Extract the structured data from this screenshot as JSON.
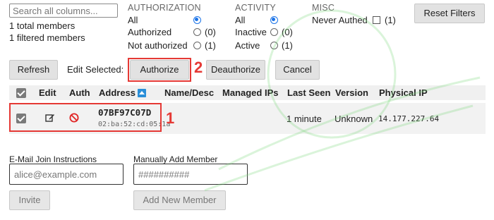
{
  "search": {
    "placeholder": "Search all columns..."
  },
  "stats": {
    "total": "1 total members",
    "filtered": "1 filtered members"
  },
  "filters": {
    "authorization": {
      "heading": "AUTHORIZATION",
      "options": [
        {
          "label": "All",
          "count": "",
          "selected": true
        },
        {
          "label": "Authorized",
          "count": "(0)",
          "selected": false
        },
        {
          "label": "Not authorized",
          "count": "(1)",
          "selected": false
        }
      ]
    },
    "activity": {
      "heading": "ACTIVITY",
      "options": [
        {
          "label": "All",
          "count": "",
          "selected": true
        },
        {
          "label": "Inactive",
          "count": "(0)",
          "selected": false
        },
        {
          "label": "Active",
          "count": "(1)",
          "selected": false
        }
      ]
    },
    "misc": {
      "heading": "MISC",
      "options": [
        {
          "label": "Never Authed",
          "count": "(1)",
          "checked": false
        }
      ]
    }
  },
  "toolbar": {
    "reset_filters": "Reset Filters",
    "refresh": "Refresh",
    "edit_selected": "Edit Selected:",
    "authorize": "Authorize",
    "deauthorize": "Deauthorize",
    "cancel": "Cancel"
  },
  "table": {
    "headers": [
      "Edit",
      "Auth",
      "Address",
      "Name/Desc",
      "Managed IPs",
      "Last Seen",
      "Version",
      "Physical IP"
    ],
    "sort_icon": "sort-ascending-icon",
    "rows": [
      {
        "selected": true,
        "edit_icon": "edit-icon",
        "auth_icon": "not-authorized-icon",
        "address": "07BF97C07D",
        "mac": "02:ba:52:cd:05:1a",
        "name": "",
        "managed_ips": "",
        "last_seen": "1 minute",
        "version": "Unknown",
        "physical_ip": "14.177.227.64"
      }
    ]
  },
  "annotations": {
    "one": "1",
    "two": "2"
  },
  "join": {
    "label": "E-Mail Join Instructions",
    "placeholder": "alice@example.com",
    "button": "Invite"
  },
  "add_member": {
    "label": "Manually Add Member",
    "placeholder": "##########",
    "button": "Add New Member"
  },
  "colors": {
    "accent": "#1a73e8",
    "annotation_red": "#e53935",
    "auth_icon_red": "#e02424",
    "sort_icon_blue": "#2b8fd8",
    "watermark_green": "#7bd67b"
  }
}
